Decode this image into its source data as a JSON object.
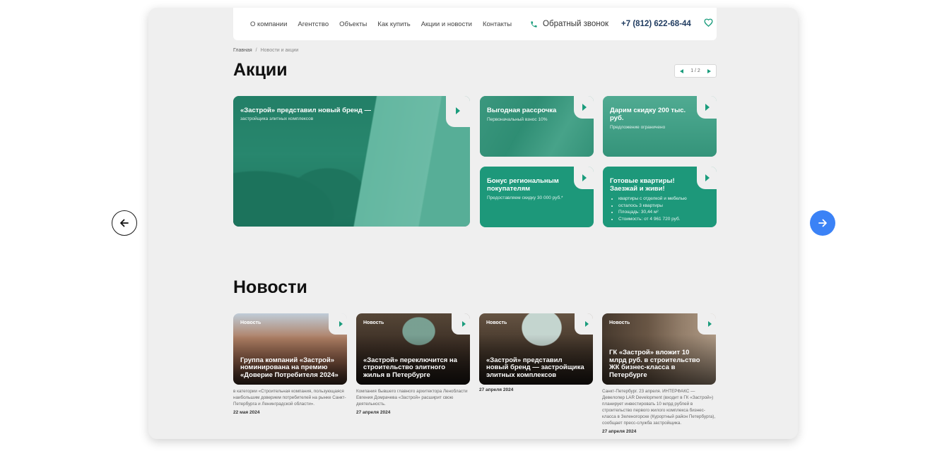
{
  "nav": {
    "items": [
      "О компании",
      "Агентство",
      "Объекты",
      "Как купить",
      "Акции и новости",
      "Контакты"
    ],
    "callback_label": "Обратный звонок",
    "phone": "+7 (812) 622-68-44"
  },
  "breadcrumb": {
    "home": "Главная",
    "separator": "/",
    "current": "Новости и акции"
  },
  "promos": {
    "title": "Акции",
    "pager": "1 / 2",
    "items": [
      {
        "title": "«Застрой» представил новый бренд —",
        "subtitle": "застройщика элитных комплексов"
      },
      {
        "title": "Выгодная рассрочка",
        "subtitle": "Первоначальный взнос 10%"
      },
      {
        "title": "Дарим скидку 200 тыс. руб.",
        "subtitle": "Предложение ограничено"
      },
      {
        "title": "Бонус региональным покупателям",
        "subtitle": "Предоставляем скидку 30 000 руб.*"
      },
      {
        "title": "Готовые квартиры! Заезжай и живи!",
        "bullets": [
          "квартиры с отделкой и мебелью",
          "осталось 3 квартиры",
          "Площадь: 30,44 м²",
          "Стоимость: от 4 961 720 руб."
        ]
      }
    ]
  },
  "news": {
    "title": "Новости",
    "items": [
      {
        "tag": "Новость",
        "title": "Группа компаний «Застрой» номинирована на премию «Доверие Потребителя 2024»",
        "desc": "в категории «Строительная компания, пользующаяся наибольшим доверием потребителей на рынке Санкт-Петербурга и Ленинградской области».",
        "date": "22 мая 2024"
      },
      {
        "tag": "Новость",
        "title": "«Застрой» переключится на строительство элитного жилья в Петербурге",
        "desc": "Компания бывшего главного архитектора Ленобласти Евгения Домрачева «Застрой» расширит свою деятельность.",
        "date": "27 апреля 2024"
      },
      {
        "tag": "Новость",
        "title": "«Застрой» представил новый бренд — застройщика элитных комплексов",
        "desc": "",
        "date": "27 апреля 2024"
      },
      {
        "tag": "Новость",
        "title": "ГК «Застрой» вложит 10 млрд руб. в строительство ЖК бизнес-класса в Петербурге",
        "desc": "Санкт-Петербург. 23 апреля. ИНТЕРФАКС — Девелопер LAR Development (входит в ГК «Застрой») планирует инвестировать 10 млрд рублей в строительство первого жилого комплекса бизнес-класса в Зеленогорске (Курортный район Петербурга), сообщает пресс-служба застройщика.",
        "date": "27 апреля 2024"
      }
    ]
  },
  "colors": {
    "accent": "#1a9c7c",
    "next_button": "#3b82f6",
    "frame_bg": "#efefef"
  },
  "icons": {
    "prev": "arrow-left-icon",
    "next": "arrow-right-icon",
    "phone": "phone-icon",
    "favorites": "heart-icon"
  }
}
